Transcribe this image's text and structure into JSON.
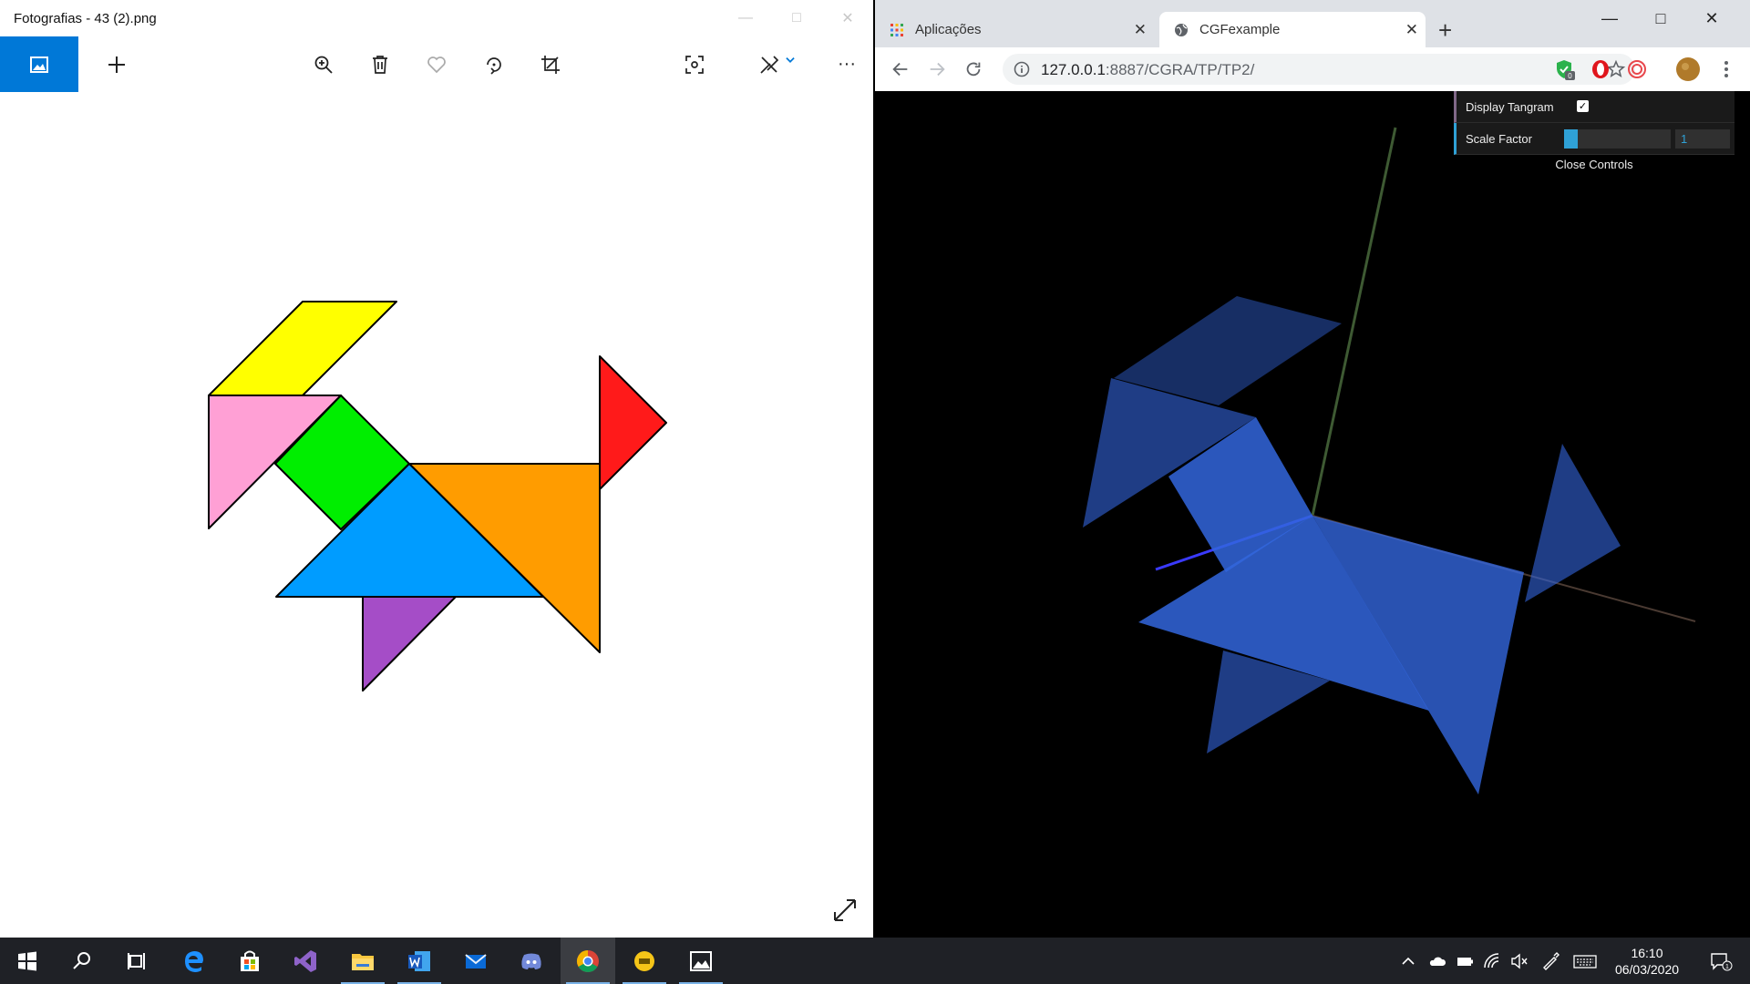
{
  "photos_window": {
    "title": "Fotografias - 43 (2).png",
    "toolbar": {
      "icons": [
        "photos-collection-icon",
        "add-icon",
        "zoom-in-icon",
        "delete-icon",
        "favorite-icon",
        "rotate-icon",
        "crop-icon",
        "enhance-icon",
        "edit-create-icon",
        "more-icon",
        "expand-icon"
      ],
      "more_label": "···"
    },
    "tangram_colors": {
      "yellow": "#ffff00",
      "pink": "#ffa0d5",
      "green": "#00ee00",
      "red": "#ff1a1a",
      "orange": "#ff9c00",
      "blue": "#009cff",
      "purple": "#a54dc7"
    }
  },
  "chrome_window": {
    "tabs": [
      {
        "label": "Aplicações"
      },
      {
        "label": "CGFexample"
      }
    ],
    "address": {
      "host": "127.0.0.1",
      "path": ":8887/CGRA/TP/TP2/"
    },
    "extension_badge": "0",
    "gui": {
      "display_tangram_label": "Display Tangram",
      "display_tangram_checked": true,
      "check_mark": "✓",
      "scale_factor_label": "Scale Factor",
      "scale_factor_value": "1",
      "scale_factor_fraction": 0.13,
      "close_controls_label": "Close Controls"
    },
    "scene_color": "#3366dd"
  },
  "taskbar": {
    "apps": [
      "windows-start",
      "search",
      "task-view",
      "edge",
      "microsoft-store",
      "visual-studio",
      "file-explorer",
      "word",
      "mail",
      "discord",
      "chrome",
      "vlc-style-app",
      "photos"
    ],
    "clock_time": "16:10",
    "clock_date": "06/03/2020",
    "notification_count": "1"
  }
}
